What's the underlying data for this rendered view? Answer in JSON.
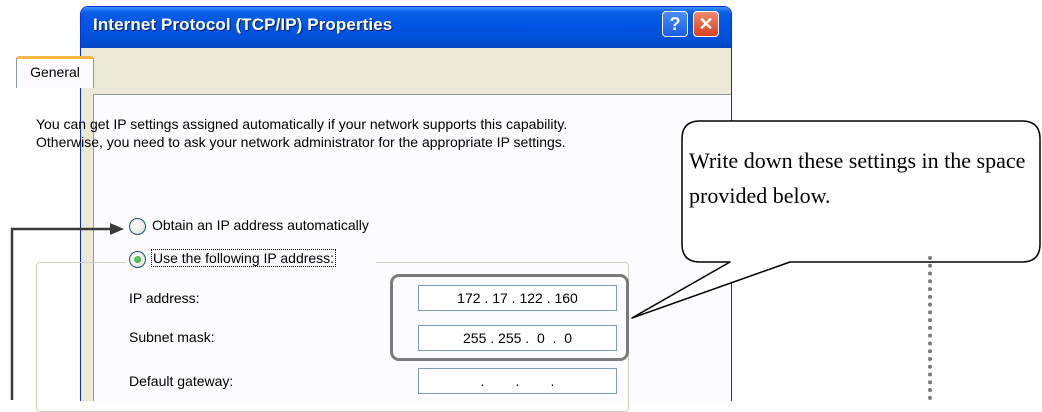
{
  "window": {
    "title": "Internet Protocol (TCP/IP) Properties",
    "help_label": "?",
    "close_label": "✕"
  },
  "tabs": [
    {
      "label": "General",
      "selected": true
    }
  ],
  "general": {
    "info_text": "You can get IP settings assigned automatically if your network supports this capability. Otherwise, you need to ask your network administrator for the appropriate IP settings.",
    "radio_auto": {
      "label": "Obtain an IP address automatically",
      "selected": false
    },
    "radio_manual": {
      "label": "Use the following IP address:",
      "selected": true
    },
    "fields": [
      {
        "label": "IP address:",
        "value": "172 . 17 . 122 . 160"
      },
      {
        "label": "Subnet mask:",
        "value": "255 . 255 .  0  .  0"
      },
      {
        "label": "Default gateway:",
        "value": "   .        .        .   "
      }
    ]
  },
  "annotation": {
    "callout_text": "Write down these settings in the space provided below."
  },
  "colors": {
    "titlebar": "#0054e3",
    "dialog_bg": "#ece9d8",
    "annotation_gray": "#7b7b7b"
  }
}
